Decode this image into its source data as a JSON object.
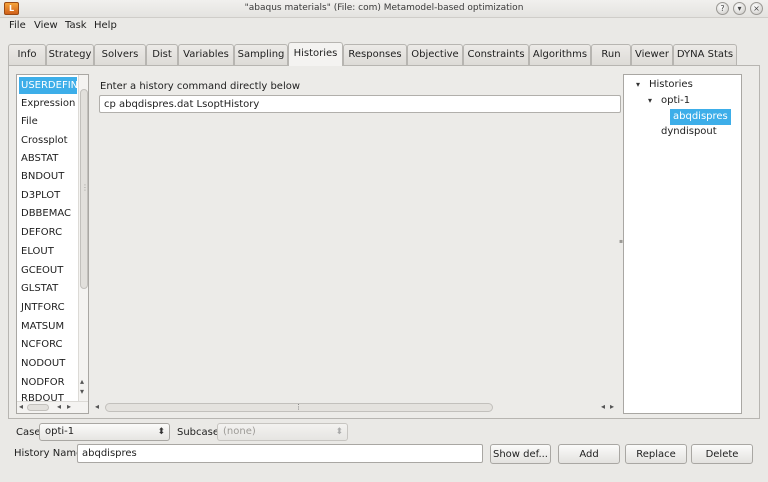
{
  "window": {
    "title": "\"abaqus materials\" (File: com)   Metamodel-based optimization",
    "app_icon": "lsopt-icon",
    "controls": [
      "help-icon",
      "minimize-icon",
      "maximize-icon",
      "close-icon"
    ]
  },
  "menu": {
    "items": [
      "File",
      "View",
      "Task",
      "Help"
    ]
  },
  "tabs": [
    "Info",
    "Strategy",
    "Solvers",
    "Dist",
    "Variables",
    "Sampling",
    "Histories",
    "Responses",
    "Objective",
    "Constraints",
    "Algorithms",
    "Run",
    "Viewer",
    "DYNA Stats"
  ],
  "active_tab": "Histories",
  "history_types": {
    "items": [
      "USERDEFINE",
      "Expression",
      "File",
      "Crossplot",
      "ABSTAT",
      "BNDOUT",
      "D3PLOT",
      "DBBEMAC",
      "DEFORC",
      "ELOUT",
      "GCEOUT",
      "GLSTAT",
      "JNTFORC",
      "MATSUM",
      "NCFORC",
      "NODOUT",
      "NODFOR",
      "RBDOUT"
    ],
    "selected": "USERDEFINE"
  },
  "editor": {
    "prompt": "Enter a history command directly below",
    "command": "cp abqdispres.dat LsoptHistory"
  },
  "tree": {
    "root": "Histories",
    "case": "opti-1",
    "histories": [
      "abqdispres",
      "dyndispout"
    ],
    "selected": "abqdispres"
  },
  "bottom": {
    "case_label": "Case",
    "case_value": "opti-1",
    "subcase_label": "Subcase",
    "subcase_value": "(none)",
    "history_name_label": "History Name",
    "history_name_value": "abqdispres",
    "buttons": {
      "show_def": "Show def...",
      "add": "Add",
      "replace": "Replace",
      "delete": "Delete"
    }
  },
  "colors": {
    "selection": "#3daee9",
    "window_bg": "#eae9e6"
  }
}
